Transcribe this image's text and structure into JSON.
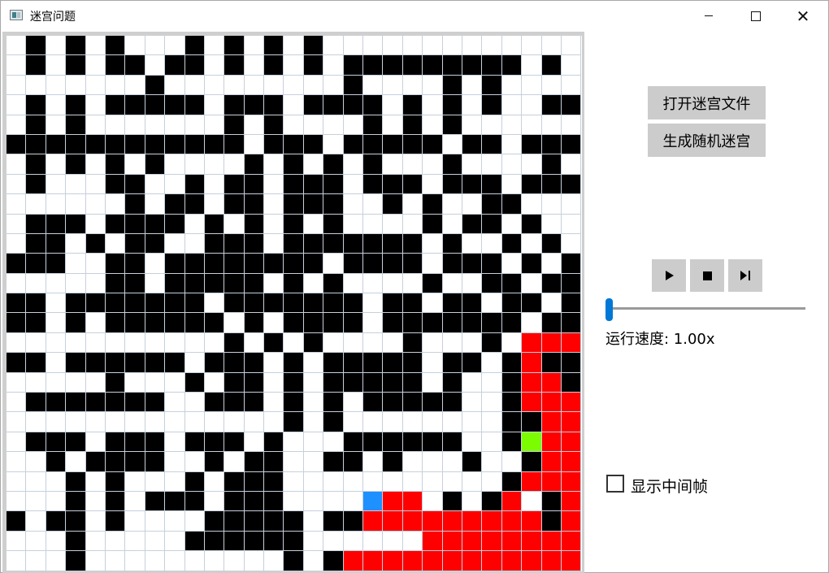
{
  "window": {
    "title": "迷宫问题",
    "controls": {
      "minimize": "minimize",
      "maximize": "maximize",
      "close": "✕"
    }
  },
  "buttons": {
    "open_maze_file": "打开迷宫文件",
    "generate_random_maze": "生成随机迷宫"
  },
  "playback": {
    "play_icon": "play-icon",
    "stop_icon": "stop-icon",
    "step_icon": "step-forward-icon"
  },
  "speed": {
    "label": "运行速度: 1.00x",
    "slider_value": 0.0
  },
  "options": {
    "show_intermediate_frames_label": "显示中间帧",
    "show_intermediate_frames_checked": false
  },
  "maze": {
    "cols": 29,
    "rows": 27,
    "legend": {
      "wall": "#000000",
      "open": "#ffffff",
      "path": "#ff0000",
      "start": "#7cfc00",
      "end": "#1e90ff"
    },
    "grid": [
      ".#.#.#...#.#.#.#.............",
      ".#.#.##.##.#.#.#.#########.#.",
      ".......#.........#....#.#....",
      ".#.#.#####.###.####.#.#.#..##",
      ".#.#.......#.#....#.#.#......",
      "############.###.#####.##.###",
      ".#.#.#.#....#.#.#.#...#....#.",
      ".#...##..#.##.###.###.###.###",
      "......#.##.##.###..#.#..##...",
      ".###.####.#.#.#.#....#.##.#..",
      ".##.#.##..###.#######.#..#.#.",
      "###..##.########.####.###.#.#",
      ".....##.#####.#.#....#..##.##",
      "##.#######.#######.##.##.##.#",
      "##.#.######.#.####.#######.##",
      "...........#.#.#....#...#.RRR",
      "##.######.###.#.#####.##.#R##",
      ".....#...#.##.#.#####.#..#RR#",
      ".#######..###.#.#.#####..#RRR",
      "..............#.#........##RR",
      ".###.###.###.#...######..#GRR",
      "..#.####..#.##..##.#...#..#RR",
      "...#.#...#.###...........#RRR",
      "...#.#.###.###....BRR.#.#R.#R",
      "#.##.#....#####.##RRRRRRRRR#R",
      "...#.....######......RRRRRRRR",
      "...#..........#.#RRRRRRRRRRRR"
    ]
  }
}
